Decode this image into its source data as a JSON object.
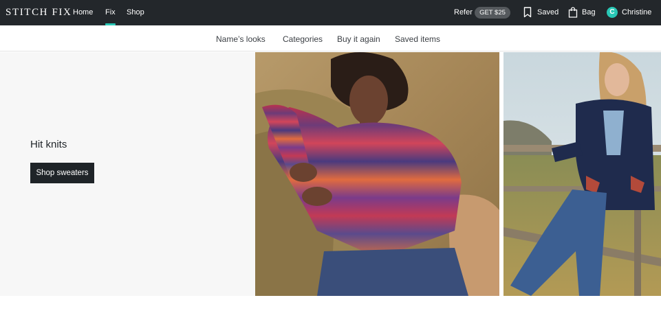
{
  "header": {
    "logo": "STITCH FIX",
    "nav": [
      {
        "label": "Home"
      },
      {
        "label": "Fix",
        "active": true
      },
      {
        "label": "Shop"
      }
    ],
    "refer_label": "Refer",
    "refer_badge": "GET $25",
    "saved_label": "Saved",
    "bag_label": "Bag",
    "user_initial": "C",
    "user_name": "Christine",
    "accent_color": "#28c7b5",
    "background_color": "#23272b"
  },
  "subnav": {
    "items": [
      "Name’s looks",
      "Categories",
      "Buy it again",
      "Saved items"
    ]
  },
  "hero": {
    "title": "Hit knits",
    "button_label": "Shop sweaters",
    "icons": [
      "bookmark-icon",
      "bag-icon"
    ]
  }
}
